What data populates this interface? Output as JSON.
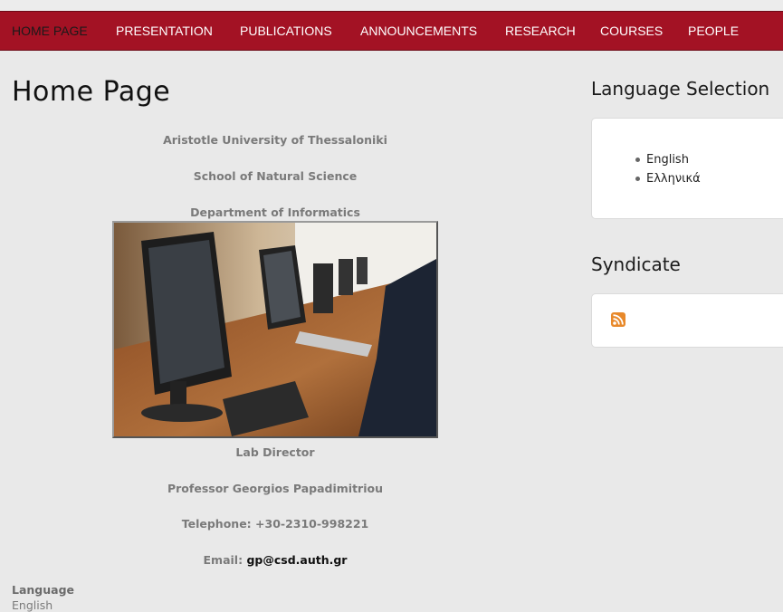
{
  "nav": {
    "items": [
      {
        "label": "Home Page",
        "active": true
      },
      {
        "label": "Presentation",
        "active": false
      },
      {
        "label": "Publications",
        "active": false
      },
      {
        "label": "Announcements",
        "active": false
      },
      {
        "label": "Research",
        "active": false
      },
      {
        "label": "Courses",
        "active": false
      },
      {
        "label": "People",
        "active": false
      }
    ]
  },
  "main": {
    "title": "Home Page",
    "university": "Aristotle University of Thessaloniki",
    "school": "School of Natural Science",
    "department": "Department of Informatics",
    "lab_director_label": "Lab Director",
    "director_name": "Professor Georgios Papadimitriou",
    "telephone": "Telephone: +30-2310-998221",
    "email_label": "Email:",
    "email_value": "gp@csd.auth.gr"
  },
  "sidebar": {
    "language_title": "Language Selection",
    "languages": [
      "English",
      "Ελληνικά"
    ],
    "syndicate_title": "Syndicate",
    "rss_icon": "rss-feed-icon"
  },
  "footer": {
    "language_heading": "Language",
    "language_value": "English"
  },
  "colors": {
    "navbar": "#a31224",
    "background": "#e9e9e9",
    "rss": "#e8892b"
  }
}
